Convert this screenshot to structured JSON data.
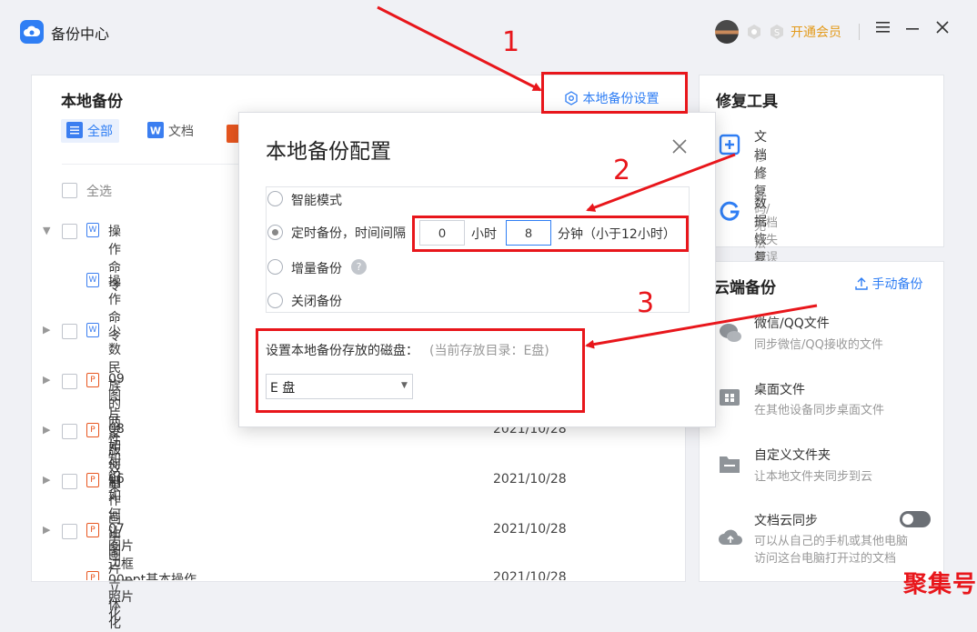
{
  "app": {
    "title": "备份中心",
    "vip_label": "开通会员",
    "menu_icon": "hamburger-icon",
    "minimize_icon": "minimize-icon",
    "close_icon": "close-icon"
  },
  "local_backup": {
    "title": "本地备份",
    "settings_link": "本地备份设置",
    "tabs": [
      {
        "label": "全部",
        "icon": "list-icon"
      },
      {
        "label": "文档",
        "icon": "word-icon"
      },
      {
        "label": "",
        "icon": "ppt-icon"
      }
    ],
    "select_all": "全选",
    "files": [
      {
        "name": "操作命令",
        "type": "word",
        "expanded": true,
        "date": ""
      },
      {
        "name": "操作命令",
        "type": "word",
        "child": true,
        "date": ""
      },
      {
        "name": "少数民族的两性知识",
        "type": "word",
        "date": ""
      },
      {
        "name": "09图片蒙版效果",
        "type": "ppt",
        "date": ""
      },
      {
        "name": "08如何制作画中画",
        "type": "ppt",
        "date": "2021/10/28"
      },
      {
        "name": "06如何让图片立体化",
        "type": "ppt",
        "date": "2021/10/28"
      },
      {
        "name": "07图片边框——照片化",
        "type": "ppt",
        "date": "2021/10/28"
      },
      {
        "name": "00ppt基本操作",
        "type": "ppt",
        "date": "2021/10/28"
      }
    ]
  },
  "repair_tools": {
    "title": "修复工具",
    "items": [
      {
        "title": "文档修复",
        "desc": "修复乱码/无法打开的文档",
        "icon": "repair-icon"
      },
      {
        "title": "数据恢复",
        "desc": "文档丢失或误删，一键恢复",
        "icon": "recover-icon"
      }
    ]
  },
  "cloud_backup": {
    "title": "云端备份",
    "manual_button": "手动备份",
    "items": [
      {
        "title": "微信/QQ文件",
        "desc": "同步微信/QQ接收的文件",
        "icon": "chat-icon"
      },
      {
        "title": "桌面文件",
        "desc": "在其他设备同步桌面文件",
        "icon": "desktop-icon"
      },
      {
        "title": "自定义文件夹",
        "desc": "让本地文件夹同步到云",
        "icon": "folder-icon"
      },
      {
        "title": "文档云同步",
        "desc": "可以从自己的手机或其他电脑访问这台电脑打开过的文档",
        "desc1": "可以从自己的手机或其他电脑",
        "desc2": "访问这台电脑打开过的文档",
        "icon": "cloud-icon",
        "toggle": "off"
      }
    ]
  },
  "dialog": {
    "title": "本地备份配置",
    "options": [
      {
        "label": "智能模式",
        "selected": false
      },
      {
        "label": "定时备份，时间间隔",
        "selected": true
      },
      {
        "label": "增量备份",
        "selected": false
      },
      {
        "label": "关闭备份",
        "selected": false
      }
    ],
    "hours_value": "0",
    "hours_unit": "小时",
    "minutes_value": "8",
    "minutes_unit": "分钟（小于12小时）",
    "disk_label": "设置本地备份存放的磁盘：",
    "disk_hint": "(当前存放目录：E盘)",
    "disk_selected": "E 盘"
  },
  "annotations": {
    "labels": [
      "1",
      "2",
      "3"
    ],
    "color": "#e8161b"
  },
  "watermark": "聚集号"
}
